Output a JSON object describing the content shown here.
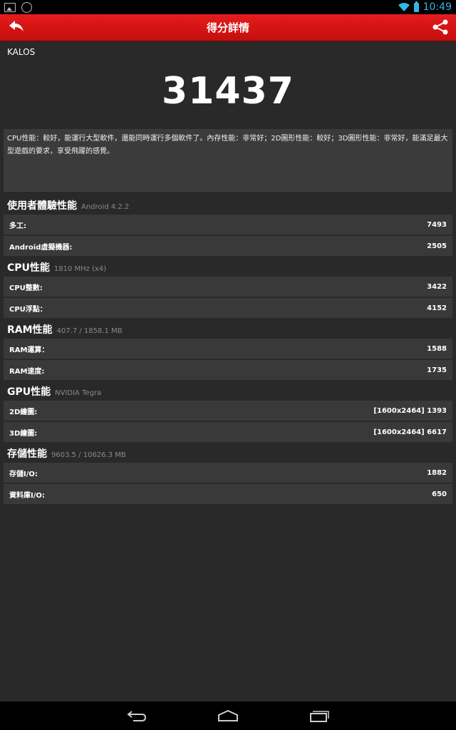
{
  "status": {
    "time": "10:49"
  },
  "header": {
    "title": "得分詳情"
  },
  "device": {
    "name": "KALOS"
  },
  "score": {
    "total": "31437"
  },
  "description": "CPU性能：較好，能運行大型軟件，還能同時運行多個軟件了。內存性能：非常好；2D圖形性能：較好；3D圖形性能：非常好，能滿足最大型遊戲的要求，享受飛躍的感覺。",
  "sections": [
    {
      "title": "使用者體驗性能",
      "sub": "Android 4.2.2",
      "rows": [
        {
          "label": "多工:",
          "value": "7493"
        },
        {
          "label": "Android虛擬機器:",
          "value": "2505"
        }
      ]
    },
    {
      "title": "CPU性能",
      "sub": "1810 MHz (x4)",
      "rows": [
        {
          "label": "CPU整數:",
          "value": "3422"
        },
        {
          "label": "CPU浮點：",
          "value": "4152"
        }
      ]
    },
    {
      "title": "RAM性能",
      "sub": "407.7 / 1858.1 MB",
      "rows": [
        {
          "label": "RAM運算：",
          "value": "1588"
        },
        {
          "label": "RAM速度:",
          "value": "1735"
        }
      ]
    },
    {
      "title": "GPU性能",
      "sub": "NVIDIA Tegra",
      "rows": [
        {
          "label": "2D繪圖:",
          "value": "[1600x2464] 1393"
        },
        {
          "label": "3D繪圖:",
          "value": "[1600x2464] 6617"
        }
      ]
    },
    {
      "title": "存儲性能",
      "sub": "9603.5 / 10626.3 MB",
      "rows": [
        {
          "label": "存儲I/O:",
          "value": "1882"
        },
        {
          "label": "資料庫I/O:",
          "value": "650"
        }
      ]
    }
  ],
  "icons": {
    "back": "back-arrow-icon",
    "share": "share-icon",
    "nav_back": "nav-back-icon",
    "nav_home": "nav-home-icon",
    "nav_recent": "nav-recent-apps-icon"
  },
  "colors": {
    "accent": "#d81414",
    "background": "#292929",
    "row": "#393939",
    "status_blue": "#33b5e5"
  }
}
